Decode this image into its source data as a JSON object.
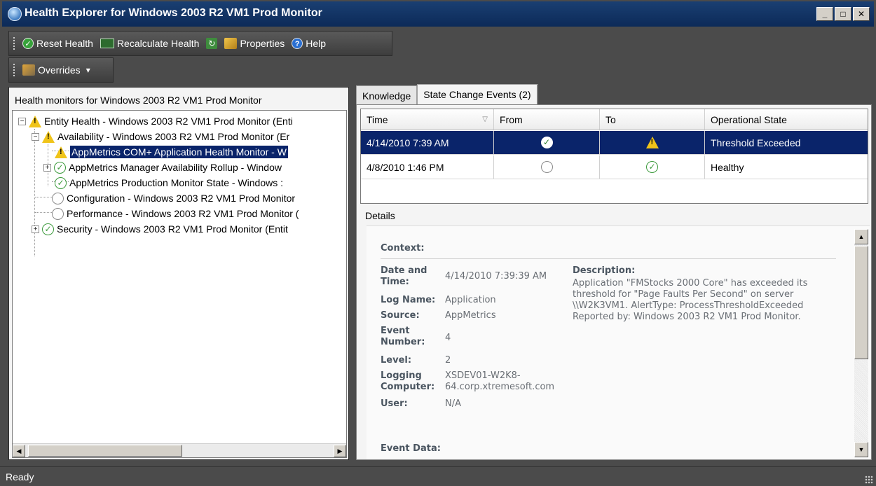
{
  "window": {
    "title": "Health Explorer for Windows 2003 R2 VM1 Prod Monitor",
    "controls": [
      "_",
      "□",
      "✕"
    ]
  },
  "toolbar": {
    "reset_health": "Reset Health",
    "recalculate_health": "Recalculate Health",
    "properties": "Properties",
    "help": "Help",
    "overrides": "Overrides",
    "overrides_arrow": "▾"
  },
  "left": {
    "header": "Health monitors for Windows 2003 R2 VM1 Prod Monitor",
    "tree": [
      {
        "label": "Entity Health - Windows 2003 R2 VM1 Prod Monitor (Enti",
        "state": "warning",
        "expander": "−"
      },
      {
        "label": "Availability - Windows 2003 R2 VM1 Prod Monitor (Er",
        "state": "warning",
        "expander": "−"
      },
      {
        "label": "AppMetrics COM+ Application Health Monitor - W",
        "state": "warning",
        "expander": ""
      },
      {
        "label": "AppMetrics Manager Availability Rollup - Window",
        "state": "healthy",
        "expander": "+"
      },
      {
        "label": "AppMetrics Production Monitor State - Windows :",
        "state": "healthy",
        "expander": ""
      },
      {
        "label": "Configuration - Windows 2003 R2 VM1 Prod Monitor",
        "state": "empty",
        "expander": ""
      },
      {
        "label": "Performance - Windows 2003 R2 VM1 Prod Monitor (",
        "state": "empty",
        "expander": ""
      },
      {
        "label": "Security - Windows 2003 R2 VM1 Prod Monitor (Entit",
        "state": "healthy",
        "expander": "+"
      }
    ],
    "scroll_left": "◀",
    "scroll_right": "▶"
  },
  "tabs": {
    "knowledge": "Knowledge",
    "state_change_events": "State Change Events (2)"
  },
  "events": {
    "columns": [
      "Time",
      "From",
      "To",
      "Operational State"
    ],
    "sort_indicator": "▽",
    "rows": [
      {
        "time": "4/14/2010 7:39 AM",
        "from": "healthy",
        "to": "warning",
        "operational_state": "Threshold Exceeded",
        "selected": true
      },
      {
        "time": "4/8/2010 1:46 PM",
        "from": "empty",
        "to": "healthy",
        "operational_state": "Healthy",
        "selected": false
      }
    ]
  },
  "details": {
    "label": "Details",
    "context_title": "Context:",
    "date_key": "Date and Time:",
    "date_val": "4/14/2010 7:39:39 AM",
    "log_key": "Log Name:",
    "log_val": "Application",
    "source_key": "Source:",
    "source_val": "AppMetrics",
    "event_key": "Event Number:",
    "event_val": "4",
    "level_key": "Level:",
    "level_val": "2",
    "computer_key": "Logging Computer:",
    "computer_val": "XSDEV01-W2K8-64.corp.xtremesoft.com",
    "user_key": "User:",
    "user_val": "N/A",
    "description_key": "Description:",
    "description_val": "Application \"FMStocks 2000 Core\" has exceeded its threshold for \"Page Faults Per Second\" on server \\\\W2K3VM1. AlertType: ProcessThresholdExceeded Reported by: Windows 2003 R2 VM1 Prod Monitor.",
    "event_data_title": "Event Data:",
    "scroll_up": "▲",
    "scroll_down": "▼"
  },
  "status": {
    "text": "Ready"
  }
}
